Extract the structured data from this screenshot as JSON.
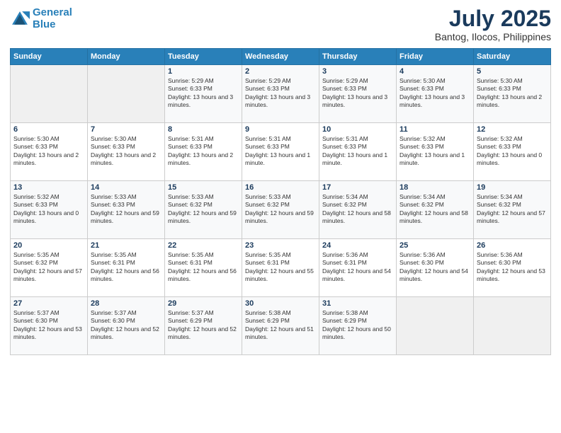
{
  "header": {
    "logo_line1": "General",
    "logo_line2": "Blue",
    "month": "July 2025",
    "location": "Bantog, Ilocos, Philippines"
  },
  "weekdays": [
    "Sunday",
    "Monday",
    "Tuesday",
    "Wednesday",
    "Thursday",
    "Friday",
    "Saturday"
  ],
  "weeks": [
    [
      {
        "day": "",
        "info": ""
      },
      {
        "day": "",
        "info": ""
      },
      {
        "day": "1",
        "info": "Sunrise: 5:29 AM\nSunset: 6:33 PM\nDaylight: 13 hours and 3 minutes."
      },
      {
        "day": "2",
        "info": "Sunrise: 5:29 AM\nSunset: 6:33 PM\nDaylight: 13 hours and 3 minutes."
      },
      {
        "day": "3",
        "info": "Sunrise: 5:29 AM\nSunset: 6:33 PM\nDaylight: 13 hours and 3 minutes."
      },
      {
        "day": "4",
        "info": "Sunrise: 5:30 AM\nSunset: 6:33 PM\nDaylight: 13 hours and 3 minutes."
      },
      {
        "day": "5",
        "info": "Sunrise: 5:30 AM\nSunset: 6:33 PM\nDaylight: 13 hours and 2 minutes."
      }
    ],
    [
      {
        "day": "6",
        "info": "Sunrise: 5:30 AM\nSunset: 6:33 PM\nDaylight: 13 hours and 2 minutes."
      },
      {
        "day": "7",
        "info": "Sunrise: 5:30 AM\nSunset: 6:33 PM\nDaylight: 13 hours and 2 minutes."
      },
      {
        "day": "8",
        "info": "Sunrise: 5:31 AM\nSunset: 6:33 PM\nDaylight: 13 hours and 2 minutes."
      },
      {
        "day": "9",
        "info": "Sunrise: 5:31 AM\nSunset: 6:33 PM\nDaylight: 13 hours and 1 minute."
      },
      {
        "day": "10",
        "info": "Sunrise: 5:31 AM\nSunset: 6:33 PM\nDaylight: 13 hours and 1 minute."
      },
      {
        "day": "11",
        "info": "Sunrise: 5:32 AM\nSunset: 6:33 PM\nDaylight: 13 hours and 1 minute."
      },
      {
        "day": "12",
        "info": "Sunrise: 5:32 AM\nSunset: 6:33 PM\nDaylight: 13 hours and 0 minutes."
      }
    ],
    [
      {
        "day": "13",
        "info": "Sunrise: 5:32 AM\nSunset: 6:33 PM\nDaylight: 13 hours and 0 minutes."
      },
      {
        "day": "14",
        "info": "Sunrise: 5:33 AM\nSunset: 6:33 PM\nDaylight: 12 hours and 59 minutes."
      },
      {
        "day": "15",
        "info": "Sunrise: 5:33 AM\nSunset: 6:32 PM\nDaylight: 12 hours and 59 minutes."
      },
      {
        "day": "16",
        "info": "Sunrise: 5:33 AM\nSunset: 6:32 PM\nDaylight: 12 hours and 59 minutes."
      },
      {
        "day": "17",
        "info": "Sunrise: 5:34 AM\nSunset: 6:32 PM\nDaylight: 12 hours and 58 minutes."
      },
      {
        "day": "18",
        "info": "Sunrise: 5:34 AM\nSunset: 6:32 PM\nDaylight: 12 hours and 58 minutes."
      },
      {
        "day": "19",
        "info": "Sunrise: 5:34 AM\nSunset: 6:32 PM\nDaylight: 12 hours and 57 minutes."
      }
    ],
    [
      {
        "day": "20",
        "info": "Sunrise: 5:35 AM\nSunset: 6:32 PM\nDaylight: 12 hours and 57 minutes."
      },
      {
        "day": "21",
        "info": "Sunrise: 5:35 AM\nSunset: 6:31 PM\nDaylight: 12 hours and 56 minutes."
      },
      {
        "day": "22",
        "info": "Sunrise: 5:35 AM\nSunset: 6:31 PM\nDaylight: 12 hours and 56 minutes."
      },
      {
        "day": "23",
        "info": "Sunrise: 5:35 AM\nSunset: 6:31 PM\nDaylight: 12 hours and 55 minutes."
      },
      {
        "day": "24",
        "info": "Sunrise: 5:36 AM\nSunset: 6:31 PM\nDaylight: 12 hours and 54 minutes."
      },
      {
        "day": "25",
        "info": "Sunrise: 5:36 AM\nSunset: 6:30 PM\nDaylight: 12 hours and 54 minutes."
      },
      {
        "day": "26",
        "info": "Sunrise: 5:36 AM\nSunset: 6:30 PM\nDaylight: 12 hours and 53 minutes."
      }
    ],
    [
      {
        "day": "27",
        "info": "Sunrise: 5:37 AM\nSunset: 6:30 PM\nDaylight: 12 hours and 53 minutes."
      },
      {
        "day": "28",
        "info": "Sunrise: 5:37 AM\nSunset: 6:30 PM\nDaylight: 12 hours and 52 minutes."
      },
      {
        "day": "29",
        "info": "Sunrise: 5:37 AM\nSunset: 6:29 PM\nDaylight: 12 hours and 52 minutes."
      },
      {
        "day": "30",
        "info": "Sunrise: 5:38 AM\nSunset: 6:29 PM\nDaylight: 12 hours and 51 minutes."
      },
      {
        "day": "31",
        "info": "Sunrise: 5:38 AM\nSunset: 6:29 PM\nDaylight: 12 hours and 50 minutes."
      },
      {
        "day": "",
        "info": ""
      },
      {
        "day": "",
        "info": ""
      }
    ]
  ]
}
